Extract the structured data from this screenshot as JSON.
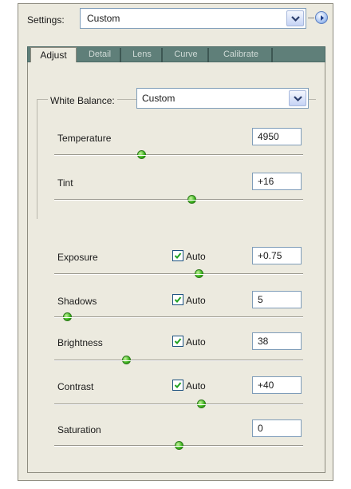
{
  "settings": {
    "label": "Settings:",
    "value": "Custom"
  },
  "tabs": [
    {
      "label": "Adjust",
      "active": true
    },
    {
      "label": "Detail",
      "active": false
    },
    {
      "label": "Lens",
      "active": false
    },
    {
      "label": "Curve",
      "active": false
    },
    {
      "label": "Calibrate",
      "active": false
    }
  ],
  "white_balance": {
    "label": "White Balance:",
    "value": "Custom",
    "temperature": {
      "label": "Temperature",
      "value": "4950",
      "level": 0.35
    },
    "tint": {
      "label": "Tint",
      "value": "+16",
      "level": 0.55
    }
  },
  "exposure": {
    "label": "Exposure",
    "auto_label": "Auto",
    "auto": true,
    "value": "+0.75",
    "level": 0.58
  },
  "shadows": {
    "label": "Shadows",
    "auto_label": "Auto",
    "auto": true,
    "value": "5",
    "level": 0.05
  },
  "brightness": {
    "label": "Brightness",
    "auto_label": "Auto",
    "auto": true,
    "value": "38",
    "level": 0.29
  },
  "contrast": {
    "label": "Contrast",
    "auto_label": "Auto",
    "auto": true,
    "value": "+40",
    "level": 0.59
  },
  "saturation": {
    "label": "Saturation",
    "value": "0",
    "level": 0.5
  },
  "colors": {
    "thumb": "#39b21b",
    "tab_strip": "#5f7f79",
    "panel": "#eceadf",
    "field_border": "#7f9db9"
  },
  "icons": {
    "dropdown": "chevron-down-icon",
    "flyout": "play-icon",
    "check": "check-icon",
    "thumb": "slider-thumb-icon"
  }
}
